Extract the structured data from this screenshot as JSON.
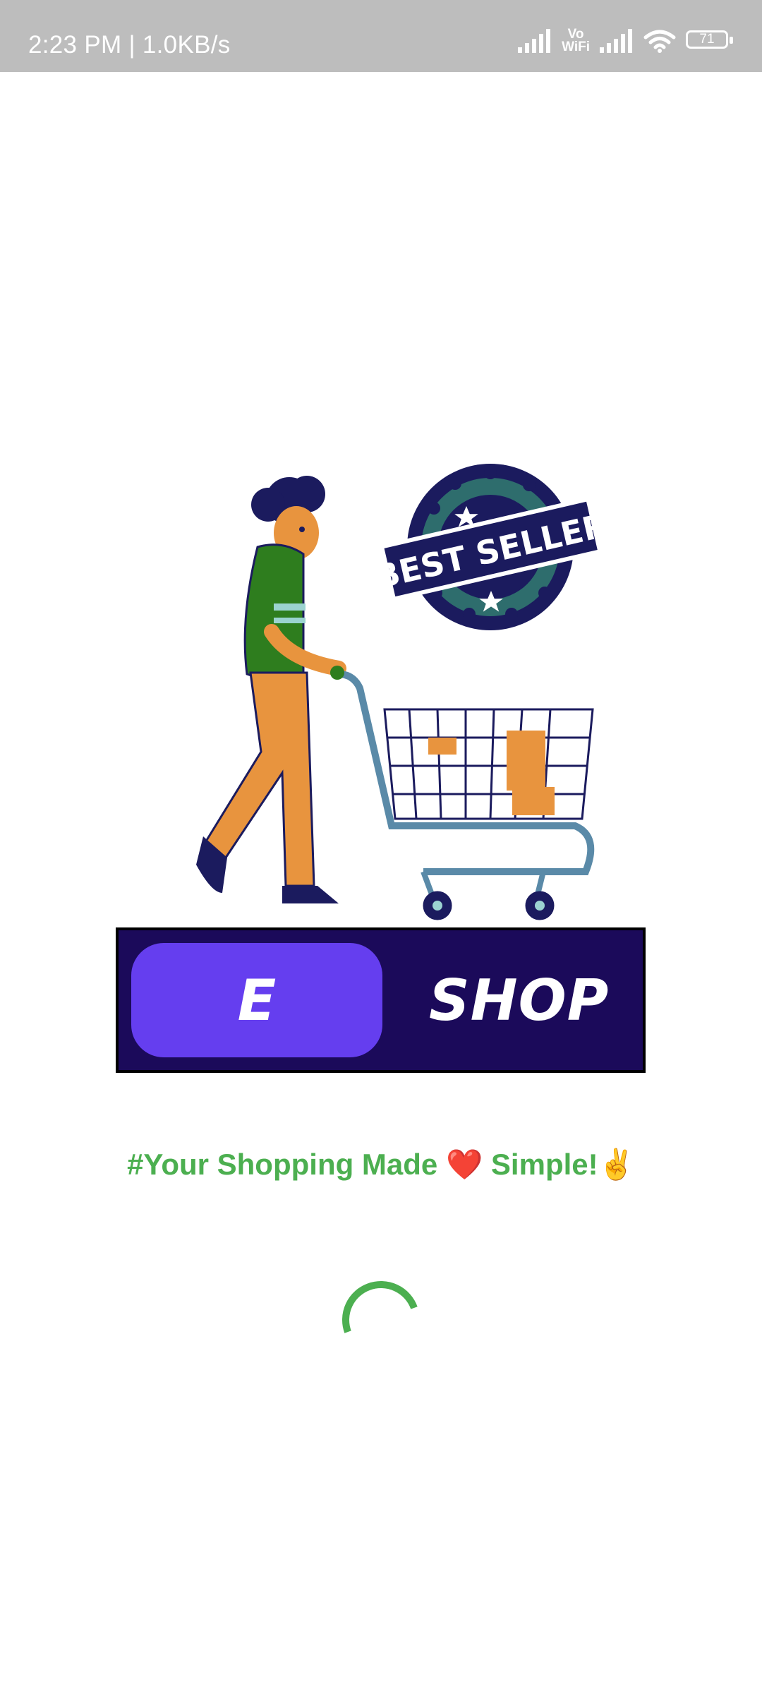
{
  "status_bar": {
    "time": "2:23 PM | 1.0KB/s",
    "vowifi_top": "Vo",
    "vowifi_bottom": "WiFi",
    "battery": "71"
  },
  "illustration": {
    "badge_text": "BEST SELLER"
  },
  "logo": {
    "letter": "E",
    "word": "SHOP"
  },
  "tagline": {
    "text_before": "#Your Shopping Made ",
    "heart": "❤️",
    "text_after": " Simple!✌️"
  },
  "colors": {
    "status_bar_bg": "#bdbdbd",
    "logo_bg": "#1b0a5a",
    "logo_pill": "#653eef",
    "tagline": "#4caf50",
    "spinner": "#4caf50"
  },
  "loading": {
    "icon": "loading-spinner"
  }
}
